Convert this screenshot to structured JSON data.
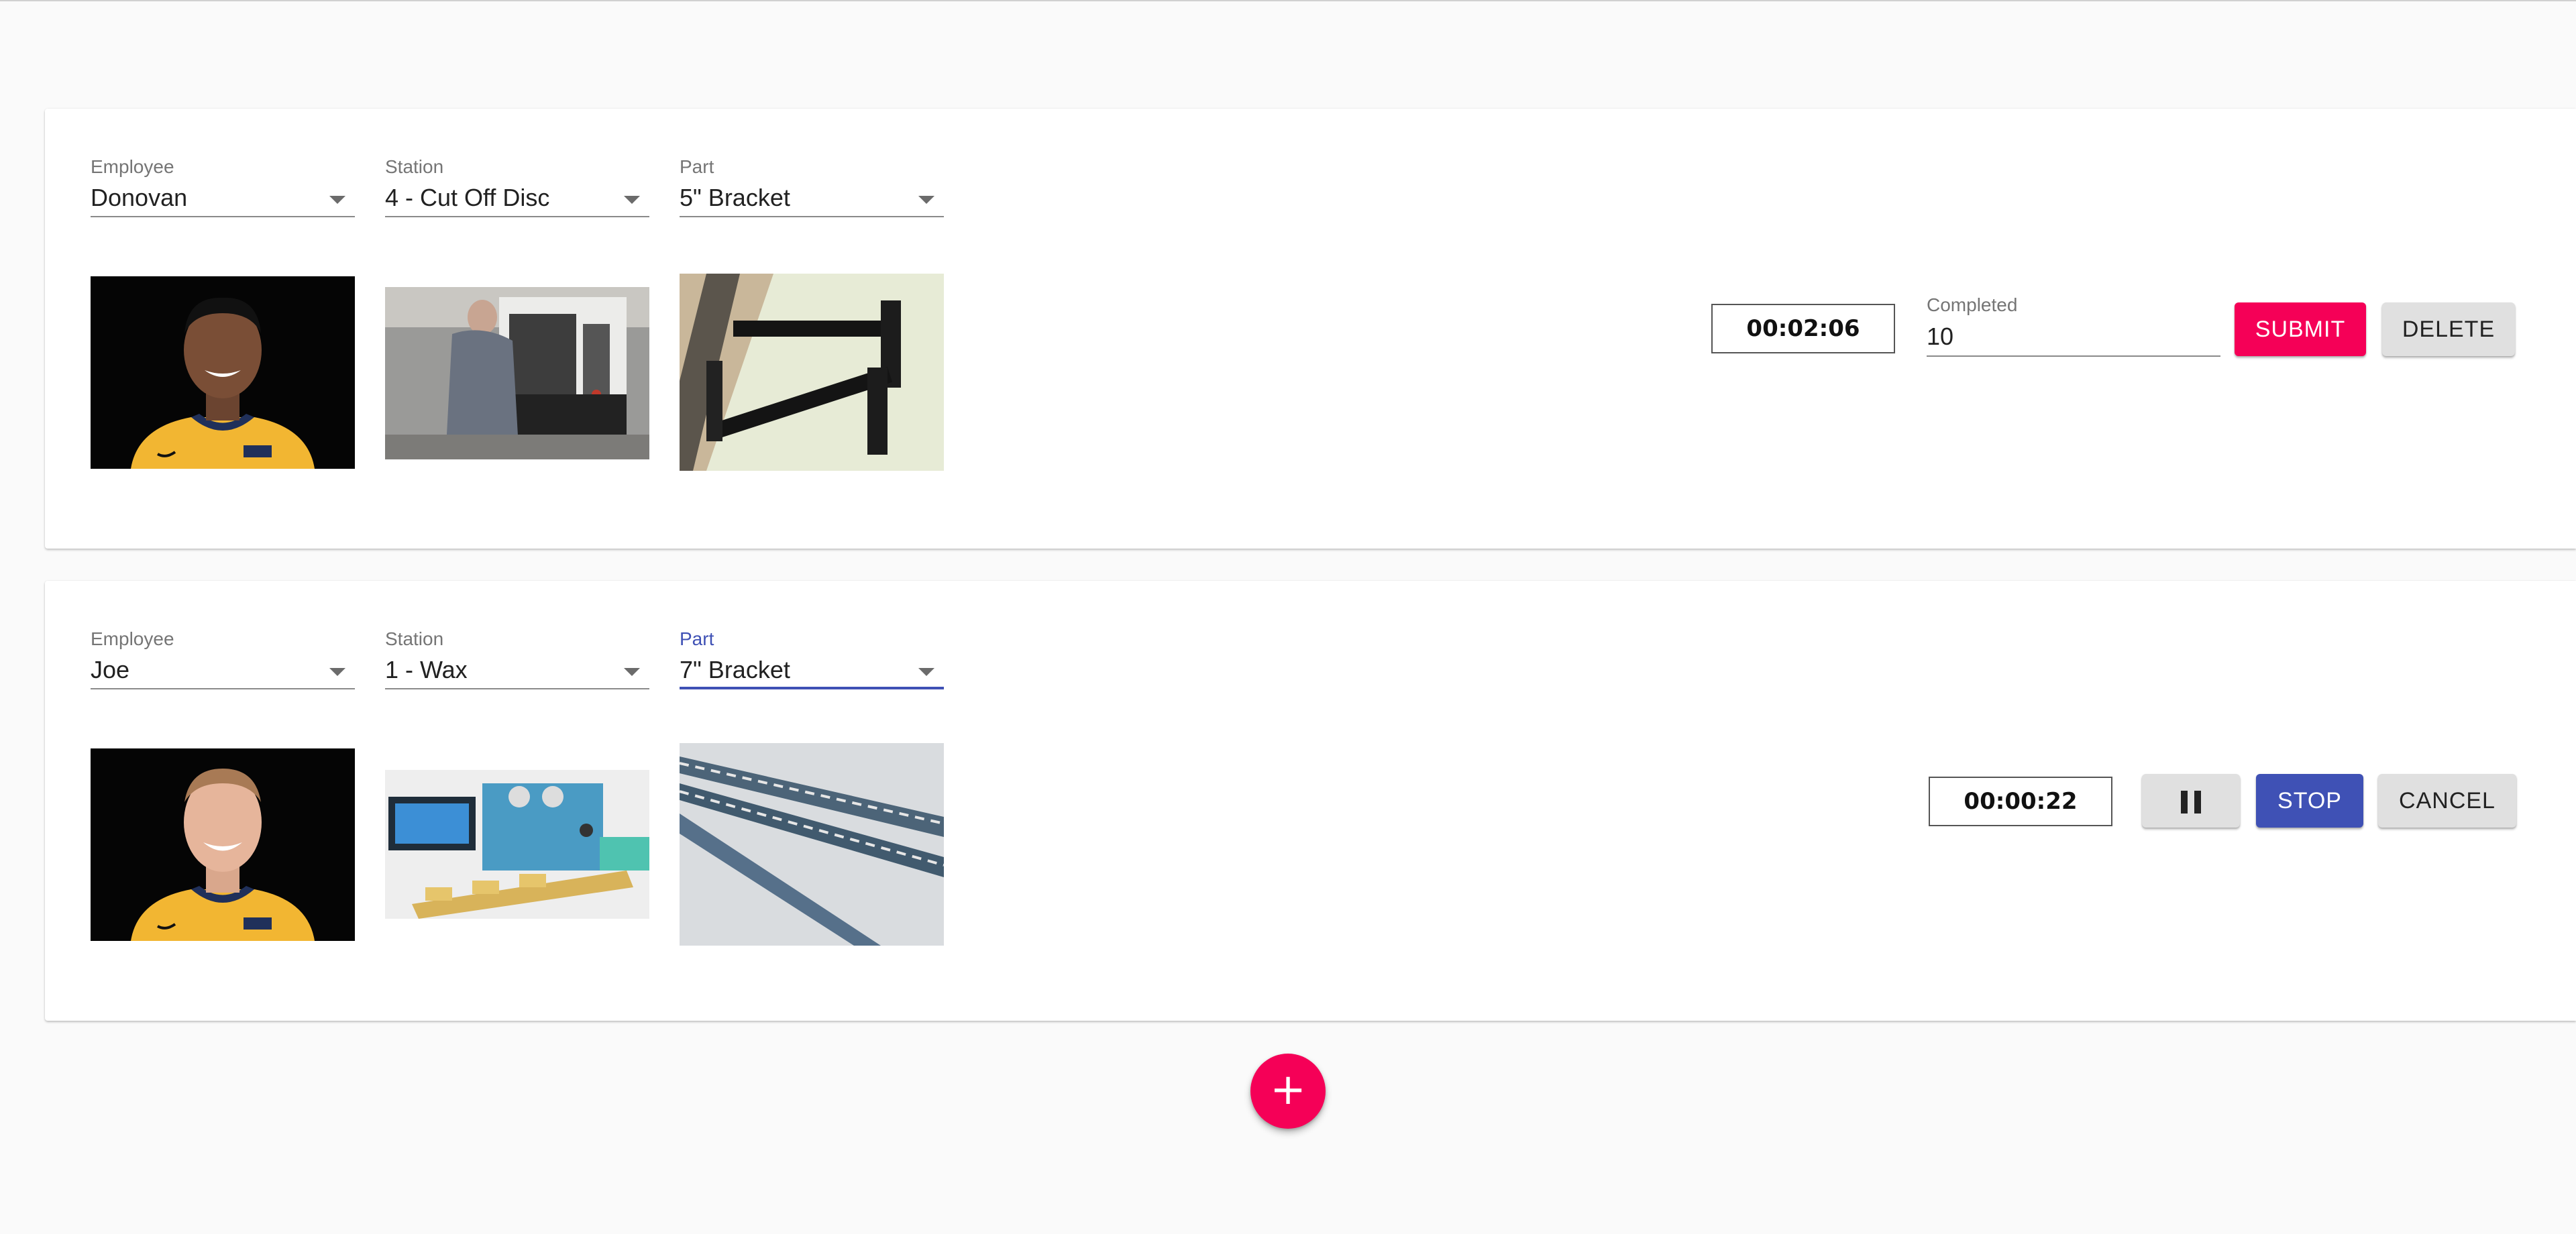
{
  "theme": {
    "accent_pink": "#f50057",
    "primary_blue": "#3f51b5",
    "button_grey": "#e0e0e0"
  },
  "cards": [
    {
      "employee": {
        "label": "Employee",
        "value": "Donovan"
      },
      "station": {
        "label": "Station",
        "value": "4 - Cut Off Disc"
      },
      "part": {
        "label": "Part",
        "value": "5\" Bracket"
      },
      "timer": "00:02:06",
      "completed": {
        "label": "Completed",
        "value": "10"
      },
      "buttons": {
        "submit": "SUBMIT",
        "delete": "DELETE"
      }
    },
    {
      "employee": {
        "label": "Employee",
        "value": "Joe"
      },
      "station": {
        "label": "Station",
        "value": "1 - Wax"
      },
      "part": {
        "label": "Part",
        "value": "7\" Bracket"
      },
      "timer": "00:00:22",
      "buttons": {
        "pause_icon": "pause-icon",
        "stop": "STOP",
        "cancel": "CANCEL"
      }
    }
  ],
  "fab": {
    "icon": "plus-icon",
    "glyph": "+"
  }
}
